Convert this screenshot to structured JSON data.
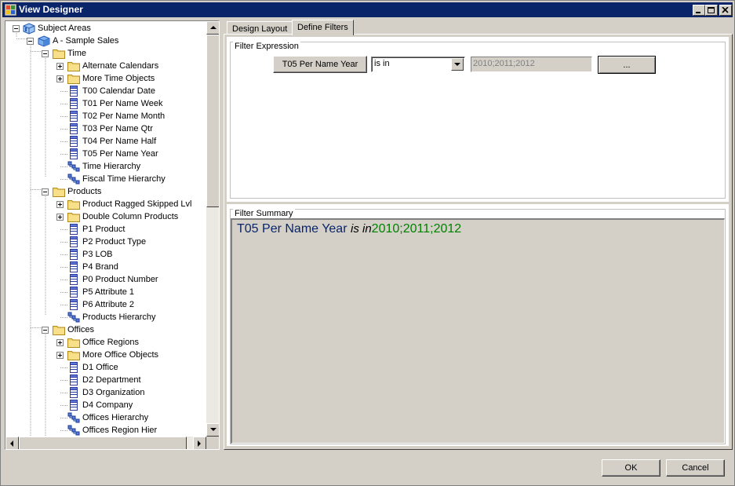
{
  "window": {
    "title": "View Designer"
  },
  "tree": {
    "nodes": [
      {
        "label": "Subject Areas",
        "icon": "subject-areas-icon"
      },
      {
        "label": "A - Sample Sales",
        "icon": "cube-icon"
      },
      {
        "label": "Time",
        "icon": "folder-icon"
      },
      {
        "label": "Alternate Calendars",
        "icon": "folder-icon"
      },
      {
        "label": "More Time Objects",
        "icon": "folder-icon"
      },
      {
        "label": "T00 Calendar Date",
        "icon": "column-icon"
      },
      {
        "label": "T01 Per Name Week",
        "icon": "column-icon"
      },
      {
        "label": "T02 Per Name Month",
        "icon": "column-icon"
      },
      {
        "label": "T03 Per Name Qtr",
        "icon": "column-icon"
      },
      {
        "label": "T04 Per Name Half",
        "icon": "column-icon"
      },
      {
        "label": "T05 Per Name Year",
        "icon": "column-icon"
      },
      {
        "label": "Time Hierarchy",
        "icon": "hierarchy-icon"
      },
      {
        "label": "Fiscal Time Hierarchy",
        "icon": "hierarchy-icon"
      },
      {
        "label": "Products",
        "icon": "folder-icon"
      },
      {
        "label": "Product Ragged Skipped Lvl",
        "icon": "folder-icon"
      },
      {
        "label": "Double Column Products",
        "icon": "folder-icon"
      },
      {
        "label": "P1  Product",
        "icon": "column-icon"
      },
      {
        "label": "P2  Product Type",
        "icon": "column-icon"
      },
      {
        "label": "P3  LOB",
        "icon": "column-icon"
      },
      {
        "label": "P4  Brand",
        "icon": "column-icon"
      },
      {
        "label": "P0  Product Number",
        "icon": "column-icon"
      },
      {
        "label": "P5  Attribute 1",
        "icon": "column-icon"
      },
      {
        "label": "P6  Attribute 2",
        "icon": "column-icon"
      },
      {
        "label": "Products Hierarchy",
        "icon": "hierarchy-icon"
      },
      {
        "label": "Offices",
        "icon": "folder-icon"
      },
      {
        "label": "Office Regions",
        "icon": "folder-icon"
      },
      {
        "label": "More Office Objects",
        "icon": "folder-icon"
      },
      {
        "label": "D1  Office",
        "icon": "column-icon"
      },
      {
        "label": "D2  Department",
        "icon": "column-icon"
      },
      {
        "label": "D3  Organization",
        "icon": "column-icon"
      },
      {
        "label": "D4  Company",
        "icon": "column-icon"
      },
      {
        "label": "Offices Hierarchy",
        "icon": "hierarchy-icon"
      },
      {
        "label": "Offices Region Hier",
        "icon": "hierarchy-icon"
      }
    ]
  },
  "tabs": [
    {
      "label": "Design Layout"
    },
    {
      "label": "Define Filters"
    }
  ],
  "filter_expression": {
    "legend": "Filter Expression",
    "column_button": "T05 Per Name Year",
    "operator_value": "is in",
    "values_text": "2010;2011;2012",
    "browse_button": "..."
  },
  "filter_summary": {
    "legend": "Filter Summary",
    "field": "T05 Per Name Year",
    "operator": "is in",
    "values": "2010;2011;2012"
  },
  "footer": {
    "ok_label": "OK",
    "cancel_label": "Cancel"
  },
  "colors": {
    "titlebar": "#0a246a",
    "summary_field": "#0a246a",
    "summary_values": "#008000"
  }
}
